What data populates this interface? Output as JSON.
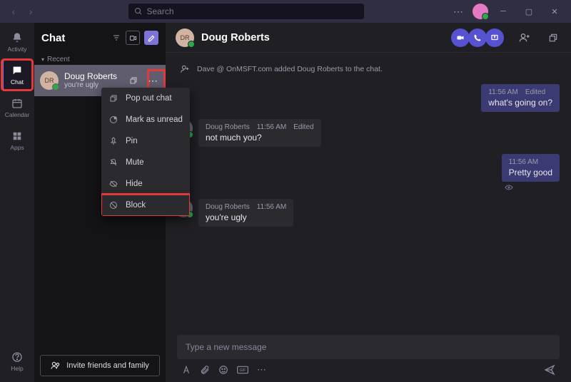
{
  "titlebar": {
    "search_placeholder": "Search"
  },
  "rail": {
    "activity": "Activity",
    "chat": "Chat",
    "calendar": "Calendar",
    "apps": "Apps",
    "help": "Help"
  },
  "chatlist": {
    "title": "Chat",
    "section_recent": "Recent",
    "item": {
      "name": "Doug Roberts",
      "preview": "you're ugly",
      "initials": "DR"
    }
  },
  "context_menu": {
    "popout": "Pop out chat",
    "unread": "Mark as unread",
    "pin": "Pin",
    "mute": "Mute",
    "hide": "Hide",
    "block": "Block"
  },
  "invite_label": "Invite friends and family",
  "chat_header": {
    "name": "Doug Roberts",
    "initials": "DR"
  },
  "system_msg": "Dave @ OnMSFT.com added Doug Roberts to the chat.",
  "messages": {
    "m1": {
      "time": "11:56 AM",
      "edited": "Edited",
      "body": "what's going on?"
    },
    "m2": {
      "author": "Doug Roberts",
      "time": "11:56 AM",
      "edited": "Edited",
      "body": "not much you?"
    },
    "m3": {
      "time": "11:56 AM",
      "body": "Pretty good"
    },
    "m4": {
      "author": "Doug Roberts",
      "time": "11:56 AM",
      "body": "you're ugly"
    }
  },
  "compose": {
    "placeholder": "Type a new message"
  }
}
